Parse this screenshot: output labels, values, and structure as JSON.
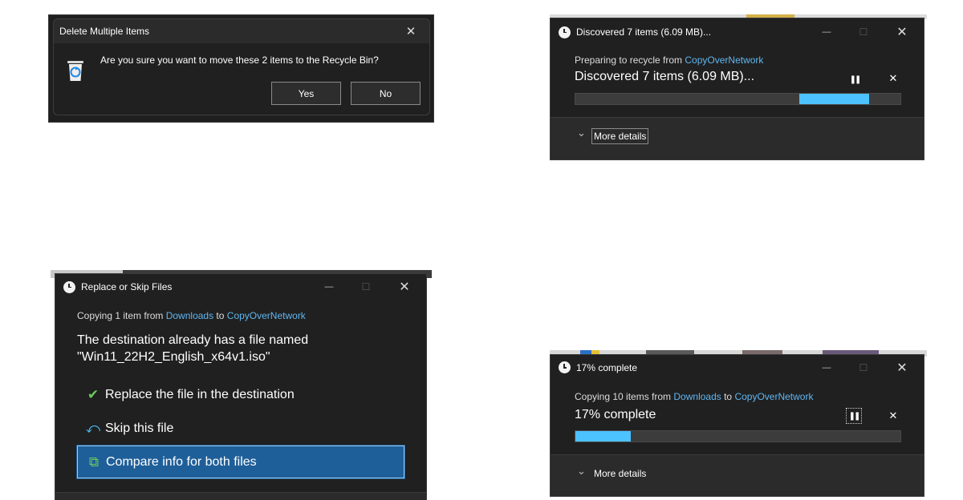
{
  "delete_dialog": {
    "title": "Delete Multiple Items",
    "close_glyph": "✕",
    "message": "Are you sure you want to move these 2 items to the Recycle Bin?",
    "yes_label": "Yes",
    "no_label": "No"
  },
  "recycle_dialog": {
    "title": "Discovered 7 items (6.09 MB)...",
    "minimize_glyph": "—",
    "maximize_glyph": "☐",
    "close_glyph": "✕",
    "source_prefix": "Preparing to recycle from ",
    "source_link": "CopyOverNetwork",
    "status": "Discovered 7 items (6.09 MB)...",
    "pause_glyph": "❚❚",
    "cancel_glyph": "✕",
    "more_details_glyph": "⌄",
    "more_details": "More details"
  },
  "replace_dialog": {
    "title": "Replace or Skip Files",
    "minimize_glyph": "—",
    "maximize_glyph": "☐",
    "close_glyph": "✕",
    "copy_prefix": "Copying 1 item from ",
    "copy_source": "Downloads",
    "copy_middle": " to ",
    "copy_dest": "CopyOverNetwork",
    "heading_line1": "The destination already has a file named",
    "heading_line2": "\"Win11_22H2_English_x64v1.iso\"",
    "options": [
      {
        "glyph": "✔",
        "label": "Replace the file in the destination"
      },
      {
        "glyph": "⤺",
        "label": "Skip this file"
      },
      {
        "glyph": "⧉",
        "label": "Compare info for both files"
      }
    ]
  },
  "copy_dialog": {
    "title": "17% complete",
    "minimize_glyph": "—",
    "maximize_glyph": "☐",
    "close_glyph": "✕",
    "copy_prefix": "Copying 10 items from ",
    "copy_source": "Downloads",
    "copy_middle": " to ",
    "copy_dest": "CopyOverNetwork",
    "status": "17% complete",
    "progress_percent": 17,
    "pause_glyph": "❚❚",
    "cancel_glyph": "✕",
    "more_details_glyph": "⌄",
    "more_details": "More details"
  },
  "colors": {
    "accent": "#4cc2ff",
    "link": "#5fb6f0",
    "dialog_bg": "#202020",
    "selection": "#1f5f99"
  }
}
